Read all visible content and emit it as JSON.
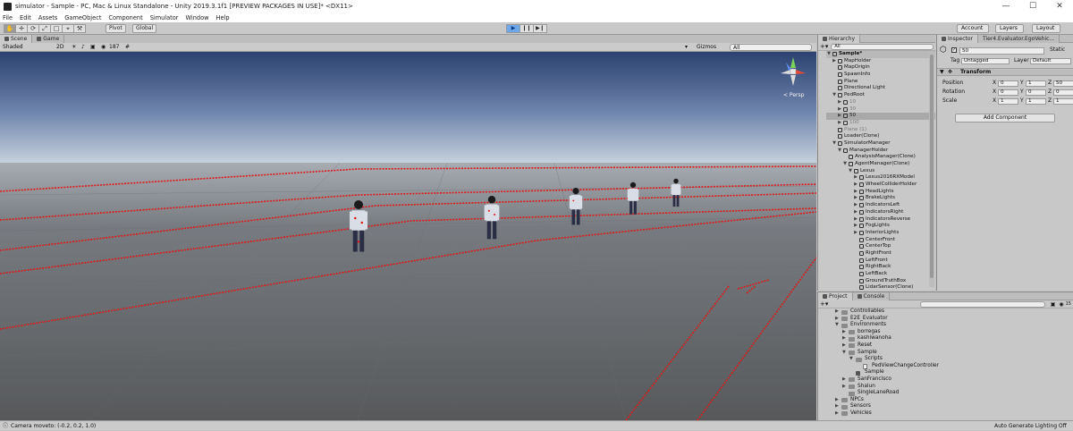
{
  "window": {
    "title": "simulator - Sample - PC, Mac & Linux Standalone - Unity 2019.3.1f1 [PREVIEW PACKAGES IN USE]* <DX11>",
    "controls": [
      "—",
      "☐",
      "✕"
    ]
  },
  "menu": [
    "File",
    "Edit",
    "Assets",
    "GameObject",
    "Component",
    "Simulator",
    "Window",
    "Help"
  ],
  "toolbar": {
    "tools": [
      "✋",
      "✛",
      "⟳",
      "⤢",
      "□",
      "⌖",
      "⚒"
    ],
    "pivot": "Pivot",
    "global": "Global",
    "play": [
      "▶",
      "❙❙",
      "▶❙"
    ],
    "account": "Account",
    "layers": "Layers",
    "layout": "Layout"
  },
  "scene": {
    "tabs": [
      "Scene",
      "Game"
    ],
    "shading": "Shaded",
    "mode2d": "2D",
    "fx_count": "187",
    "gizmos": "Gizmos",
    "search_prefix": "All",
    "persp": "< Persp"
  },
  "hierarchy": {
    "tab": "Hierarchy",
    "search_prefix": "All",
    "rows": [
      {
        "label": "Sample*",
        "indent": 0,
        "arrow": "▼",
        "head": true
      },
      {
        "label": "MapHolder",
        "indent": 1,
        "arrow": "▶"
      },
      {
        "label": "MapOrigin",
        "indent": 1,
        "arrow": ""
      },
      {
        "label": "SpawnInfo",
        "indent": 1,
        "arrow": ""
      },
      {
        "label": "Plane",
        "indent": 1,
        "arrow": ""
      },
      {
        "label": "Directional Light",
        "indent": 1,
        "arrow": ""
      },
      {
        "label": "PedRoot",
        "indent": 1,
        "arrow": "▼"
      },
      {
        "label": "10",
        "indent": 2,
        "arrow": "▶",
        "dim": true
      },
      {
        "label": "30",
        "indent": 2,
        "arrow": "▶",
        "dim": true
      },
      {
        "label": "50",
        "indent": 2,
        "arrow": "▶",
        "sel": true
      },
      {
        "label": "100",
        "indent": 2,
        "arrow": "▶",
        "dim": true
      },
      {
        "label": "Plane (1)",
        "indent": 1,
        "arrow": "",
        "dim": true
      },
      {
        "label": "Loader(Clone)",
        "indent": 1,
        "arrow": ""
      },
      {
        "label": "SimulatorManager",
        "indent": 1,
        "arrow": "▼"
      },
      {
        "label": "ManagerHolder",
        "indent": 2,
        "arrow": "▼"
      },
      {
        "label": "AnalysisManager(Clone)",
        "indent": 3,
        "arrow": ""
      },
      {
        "label": "AgentManager(Clone)",
        "indent": 3,
        "arrow": "▼"
      },
      {
        "label": "Lexus",
        "indent": 4,
        "arrow": "▼"
      },
      {
        "label": "Lexus2016RXModel",
        "indent": 5,
        "arrow": "▶"
      },
      {
        "label": "WheelColliderHolder",
        "indent": 5,
        "arrow": "▶"
      },
      {
        "label": "HeadLights",
        "indent": 5,
        "arrow": "▶"
      },
      {
        "label": "BrakeLights",
        "indent": 5,
        "arrow": "▶"
      },
      {
        "label": "IndicatorsLeft",
        "indent": 5,
        "arrow": "▶"
      },
      {
        "label": "IndicatorsRight",
        "indent": 5,
        "arrow": "▶"
      },
      {
        "label": "IndicatorsReverse",
        "indent": 5,
        "arrow": "▶"
      },
      {
        "label": "FogLights",
        "indent": 5,
        "arrow": "▶"
      },
      {
        "label": "InteriorLights",
        "indent": 5,
        "arrow": "▶"
      },
      {
        "label": "CenterFront",
        "indent": 5,
        "arrow": ""
      },
      {
        "label": "CenterTop",
        "indent": 5,
        "arrow": ""
      },
      {
        "label": "RightFront",
        "indent": 5,
        "arrow": ""
      },
      {
        "label": "LeftFront",
        "indent": 5,
        "arrow": ""
      },
      {
        "label": "RightBack",
        "indent": 5,
        "arrow": ""
      },
      {
        "label": "LeftBack",
        "indent": 5,
        "arrow": ""
      },
      {
        "label": "GroundTruthBox",
        "indent": 5,
        "arrow": ""
      },
      {
        "label": "LidarSensor(Clone)",
        "indent": 5,
        "arrow": ""
      }
    ]
  },
  "inspector": {
    "tabs": [
      "Inspector",
      "Tier4.Evaluator.EgoVehic..."
    ],
    "name": "50",
    "static_label": "Static",
    "tag_label": "Tag",
    "tag": "Untagged",
    "layer_label": "Layer",
    "layer": "Default",
    "transform": "Transform",
    "position": {
      "label": "Position",
      "x": "0",
      "y": "1",
      "z": "50"
    },
    "rotation": {
      "label": "Rotation",
      "x": "0",
      "y": "0",
      "z": "0"
    },
    "scale": {
      "label": "Scale",
      "x": "1",
      "y": "1",
      "z": "1"
    },
    "axis": [
      "X",
      "Y",
      "Z"
    ],
    "add_component": "Add Component"
  },
  "project": {
    "tabs": [
      "Project",
      "Console"
    ],
    "badge": "15",
    "rows": [
      {
        "label": "Controllables",
        "indent": 2,
        "arrow": "▶",
        "type": "folder"
      },
      {
        "label": "E2E_Evaluator",
        "indent": 2,
        "arrow": "▶",
        "type": "folder"
      },
      {
        "label": "Environments",
        "indent": 2,
        "arrow": "▼",
        "type": "folder"
      },
      {
        "label": "borregas",
        "indent": 3,
        "arrow": "▶",
        "type": "folder"
      },
      {
        "label": "kashiwanoha",
        "indent": 3,
        "arrow": "▶",
        "type": "folder"
      },
      {
        "label": "Reset",
        "indent": 3,
        "arrow": "▶",
        "type": "folder"
      },
      {
        "label": "Sample",
        "indent": 3,
        "arrow": "▼",
        "type": "folder"
      },
      {
        "label": "Scripts",
        "indent": 4,
        "arrow": "▼",
        "type": "folder"
      },
      {
        "label": "PedViewChangeController",
        "indent": 5,
        "arrow": "",
        "type": "script"
      },
      {
        "label": "Sample",
        "indent": 4,
        "arrow": "",
        "type": "scene"
      },
      {
        "label": "SanFrancisco",
        "indent": 3,
        "arrow": "▶",
        "type": "folder"
      },
      {
        "label": "Shalun",
        "indent": 3,
        "arrow": "▶",
        "type": "folder"
      },
      {
        "label": "SingleLaneRoad",
        "indent": 3,
        "arrow": "",
        "type": "folder"
      },
      {
        "label": "NPCs",
        "indent": 2,
        "arrow": "▶",
        "type": "folder"
      },
      {
        "label": "Sensors",
        "indent": 2,
        "arrow": "▶",
        "type": "folder"
      },
      {
        "label": "Vehicles",
        "indent": 2,
        "arrow": "▶",
        "type": "folder"
      }
    ]
  },
  "status": {
    "message": "Camera moveto: (-0.2, 0.2, 1.0)",
    "right": "Auto Generate Lighting Off"
  },
  "colors": {
    "accent": "#e02020",
    "panel": "#c8c8c8",
    "selection": "#a9a9a9",
    "play_active": "#6ea8e8"
  }
}
